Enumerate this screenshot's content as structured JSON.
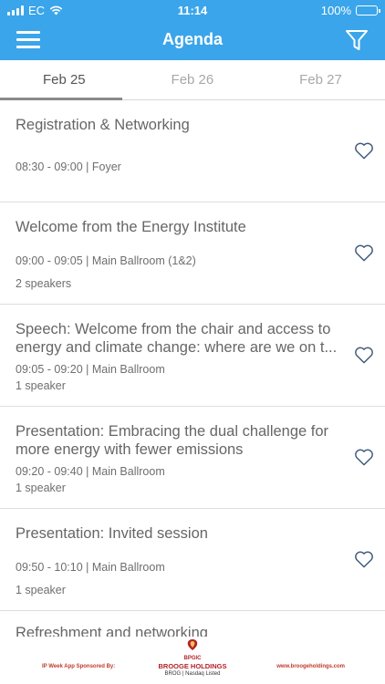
{
  "status_bar": {
    "carrier": "EC",
    "time": "11:14",
    "battery": "100%"
  },
  "header": {
    "title": "Agenda",
    "background_color": "#3aa5ea"
  },
  "tabs": [
    {
      "label": "Feb 25",
      "active": true
    },
    {
      "label": "Feb 26",
      "active": false
    },
    {
      "label": "Feb 27",
      "active": false
    }
  ],
  "sessions": [
    {
      "title": "Registration & Networking",
      "time_location": "08:30 - 09:00 | Foyer",
      "speakers": ""
    },
    {
      "title": "Welcome from the Energy Institute",
      "time_location": "09:00 - 09:05 | Main Ballroom (1&2)",
      "speakers": "2 speakers"
    },
    {
      "title": "Speech: Welcome from the chair and access to energy and climate change: where are we on t...",
      "time_location": "09:05 - 09:20 | Main Ballroom",
      "speakers": "1 speaker"
    },
    {
      "title": "Presentation: Embracing the dual challenge for more energy with fewer emissions",
      "time_location": "09:20 - 09:40 | Main Ballroom",
      "speakers": "1 speaker"
    },
    {
      "title": "Presentation: Invited session",
      "time_location": "09:50 - 10:10 | Main Ballroom",
      "speakers": "1 speaker"
    }
  ],
  "partial_session": {
    "title": "Refreshment and networking"
  },
  "footer": {
    "sponsor_text": "IP Week App Sponsored By:",
    "logo_abbrev": "BPGIC",
    "logo_name": "BROOGE HOLDINGS",
    "logo_listing": "BROG | Nasdaq Listed",
    "website": "www.broogeholdings.com"
  }
}
